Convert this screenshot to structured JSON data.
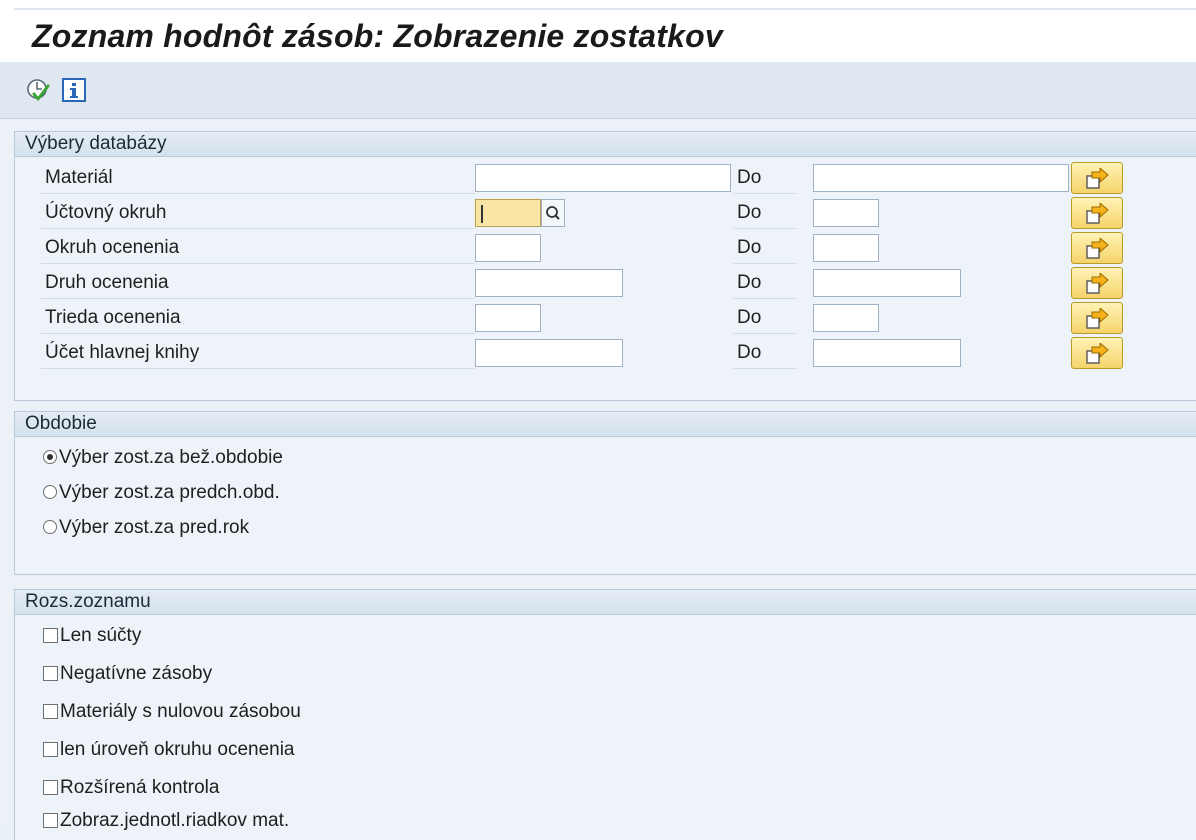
{
  "app": {
    "title": "Zoznam hodnôt zásob: Zobrazenie zostatkov"
  },
  "toolbar": {
    "buttons": [
      {
        "icon": "execute-icon"
      },
      {
        "icon": "info-icon"
      }
    ]
  },
  "database_selections": {
    "header": "Výbery databázy",
    "to_label": "Do",
    "rows": [
      {
        "label": "Materiál",
        "from_value": "",
        "to_value": ""
      },
      {
        "label": "Účtovný okruh",
        "from_value": "",
        "to_value": ""
      },
      {
        "label": "Okruh ocenenia",
        "from_value": "",
        "to_value": ""
      },
      {
        "label": "Druh ocenenia",
        "from_value": "",
        "to_value": ""
      },
      {
        "label": "Trieda ocenenia",
        "from_value": "",
        "to_value": ""
      },
      {
        "label": "Účet hlavnej knihy",
        "from_value": "",
        "to_value": ""
      }
    ]
  },
  "period": {
    "header": "Obdobie",
    "options": [
      {
        "label": "Výber zost.za bež.obdobie",
        "selected": true
      },
      {
        "label": "Výber zost.za predch.obd.",
        "selected": false
      },
      {
        "label": "Výber zost.za pred.rok",
        "selected": false
      }
    ]
  },
  "list_scope": {
    "header": "Rozs.zoznamu",
    "options": [
      {
        "label": "Len súčty",
        "checked": false
      },
      {
        "label": "Negatívne zásoby",
        "checked": false
      },
      {
        "label": "Materiály s nulovou zásobou",
        "checked": false
      },
      {
        "label": "len úroveň okruhu ocenenia",
        "checked": false
      },
      {
        "label": "Rozšírená kontrola",
        "checked": false
      },
      {
        "label": "Zobraz.jednotl.riadkov mat.",
        "checked": false
      }
    ]
  },
  "colors": {
    "accent_yellow": "#f5d36a",
    "focus_field": "#f9e6a6",
    "group_header": "#d5e1ec",
    "background": "#ebf1f7"
  }
}
